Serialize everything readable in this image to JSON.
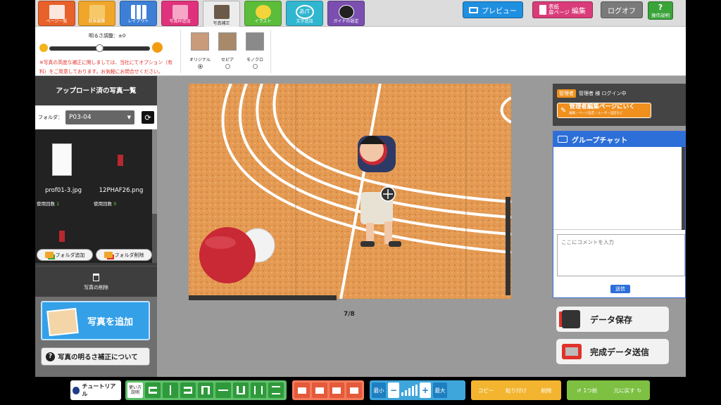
{
  "toolbar": {
    "tools": [
      {
        "label": "ページ一覧",
        "color": "#e8612b"
      },
      {
        "label": "背景編集",
        "color": "#f0a62a"
      },
      {
        "label": "レイアウト",
        "color": "#3d7fd6"
      },
      {
        "label": "写真枠追加",
        "color": "#e0327c"
      },
      {
        "label": "写真補正",
        "color": "#ececec"
      },
      {
        "label": "イラスト",
        "color": "#5bbd3a"
      },
      {
        "label": "文字追加",
        "color": "#31b6d0"
      },
      {
        "label": "ガイドの設定",
        "color": "#7a4fb0"
      }
    ],
    "text_icon_label": "あ/T",
    "preview_label": "プレビュー",
    "cover_label_line1": "表紙",
    "cover_label_line2": "扉ページ",
    "cover_edit_label": "編集",
    "logoff_label": "ログオフ",
    "help_label": "操作説明",
    "help_icon": "?"
  },
  "options": {
    "brightness_label": "明るさ調整：±0",
    "brightness_value": 0.5,
    "notice": "※写真の高度な補正に関しましては、当社にてオプション（有料）をご用意しております。お気軽にお問合せください。",
    "color_modes": [
      {
        "label": "オリジナル",
        "selected": true
      },
      {
        "label": "セピア",
        "selected": false
      },
      {
        "label": "モノクロ",
        "selected": false
      }
    ]
  },
  "left_panel": {
    "title": "アップロード済の写真一覧",
    "folder_label": "フォルダ：",
    "folder_value": "P03-04",
    "photos": [
      {
        "name": "prof01-3.jpg",
        "usage_label": "使用回数",
        "usage_count": "1"
      },
      {
        "name": "12PHAF26.png",
        "usage_label": "使用回数",
        "usage_count": "0"
      }
    ],
    "add_folder_label": "フォルダ追加",
    "delete_folder_label": "フォルダ削除",
    "delete_photo_label": "写真の削除",
    "add_photo_label": "写真を追加",
    "brightness_info_label": "写真の明るさ補正について",
    "brightness_info_icon": "?"
  },
  "canvas": {
    "page_indicator": "7/8"
  },
  "right_panel": {
    "admin_badge": "管理者",
    "admin_status": "管理者 様 ログイン中",
    "admin_edit_label": "管理者編集ページにいく",
    "admin_edit_sub": "編集・ページ設定・ユーザー設定など",
    "chat_title": "グループチャット",
    "comment_placeholder": "ここにコメントを入力",
    "send_label": "送信",
    "save_label": "データ保存",
    "submit_label": "完成データ送信"
  },
  "bottom": {
    "tutorial_label": "チュートリアル",
    "usage_label_1": "使い方",
    "usage_label_2": "説明",
    "zoom_min_label": "最小",
    "zoom_max_label": "最大",
    "copy_label": "コピー",
    "paste_label": "貼り付け",
    "delete_label": "削除",
    "undo_label": "1つ前",
    "redo_label": "元に戻す"
  }
}
